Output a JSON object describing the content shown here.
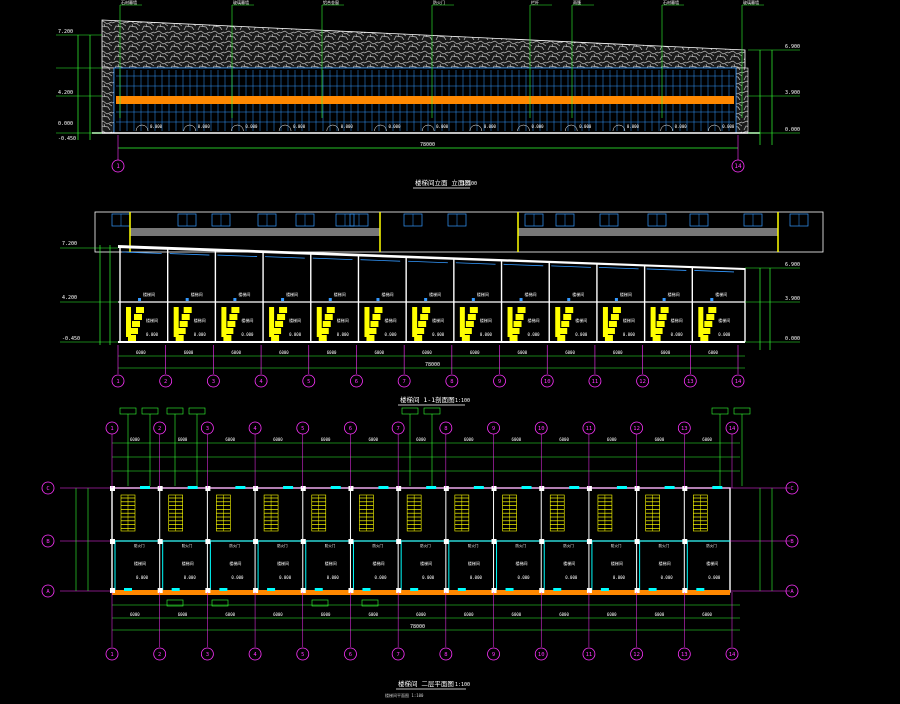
{
  "drawing": {
    "colors": {
      "background": "#000000",
      "outline": "#ffffff",
      "axis": "#ff33ff",
      "dim": "#33ff33",
      "window": "#3399ff",
      "stair": "#ffff00",
      "cyan": "#00ffff",
      "orange": "#ff8800",
      "stone": "#c8c8c8",
      "red": "#ff4444"
    },
    "axis_labels": [
      "1",
      "2",
      "3",
      "4",
      "5",
      "6",
      "7",
      "8",
      "9",
      "10",
      "11",
      "12",
      "13",
      "14"
    ],
    "row_labels": [
      "C",
      "B",
      "A"
    ],
    "titles": {
      "elevation": "楼梯间立面 立面图",
      "section": "楼梯间 1-1剖面图",
      "plan": "楼梯间 二层平面图",
      "scale": "1:100"
    },
    "plan_subtitle": "楼梯间平面图 1:100",
    "elevation_levels": [
      "7.200",
      "4.200",
      "0.000",
      "-0.450"
    ],
    "right_levels": [
      "6.900",
      "3.900",
      "0.000"
    ],
    "total_length": "78000",
    "bay_width": "6000",
    "floor_heights": [
      "3600",
      "3000"
    ],
    "room_tag": "楼梯间",
    "callouts": [
      "石材幕墙",
      "玻璃幕墙",
      "铝合金窗",
      "防火门",
      "栏杆",
      "雨篷"
    ]
  }
}
